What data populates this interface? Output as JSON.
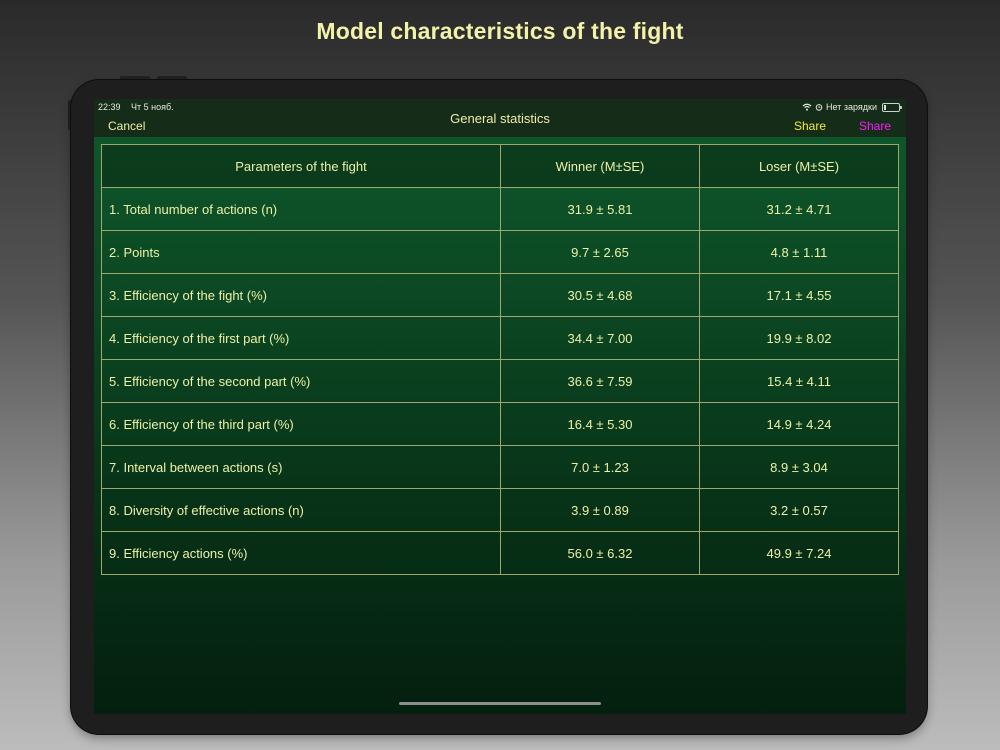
{
  "page_title": "Model characteristics of the fight",
  "status_bar": {
    "time": "22:39",
    "date": "Чт 5 нояб.",
    "charging": "Нет зарядки"
  },
  "nav": {
    "cancel": "Cancel",
    "title": "General statistics",
    "share1": "Share",
    "share2": "Share"
  },
  "table": {
    "headers": [
      "Parameters of the fight",
      "Winner (M±SE)",
      "Loser (M±SE)"
    ],
    "rows": [
      [
        "1. Total number of actions (n)",
        "31.9 ± 5.81",
        "31.2 ± 4.71"
      ],
      [
        "2. Points",
        "9.7 ± 2.65",
        "4.8 ± 1.11"
      ],
      [
        "3. Efficiency of the fight (%)",
        "30.5 ± 4.68",
        "17.1 ± 4.55"
      ],
      [
        "4. Efficiency of the first part (%)",
        "34.4 ± 7.00",
        "19.9 ± 8.02"
      ],
      [
        "5. Efficiency of the second part (%)",
        "36.6 ± 7.59",
        "15.4 ± 4.11"
      ],
      [
        "6. Efficiency of the third part (%)",
        "16.4 ± 5.30",
        "14.9 ± 4.24"
      ],
      [
        "7. Interval between actions (s)",
        "7.0 ± 1.23",
        "8.9 ± 3.04"
      ],
      [
        "8. Diversity of effective actions (n)",
        "3.9 ± 0.89",
        "3.2 ± 0.57"
      ],
      [
        "9. Efficiency actions (%)",
        "56.0 ± 6.32",
        "49.9 ± 7.24"
      ]
    ]
  }
}
